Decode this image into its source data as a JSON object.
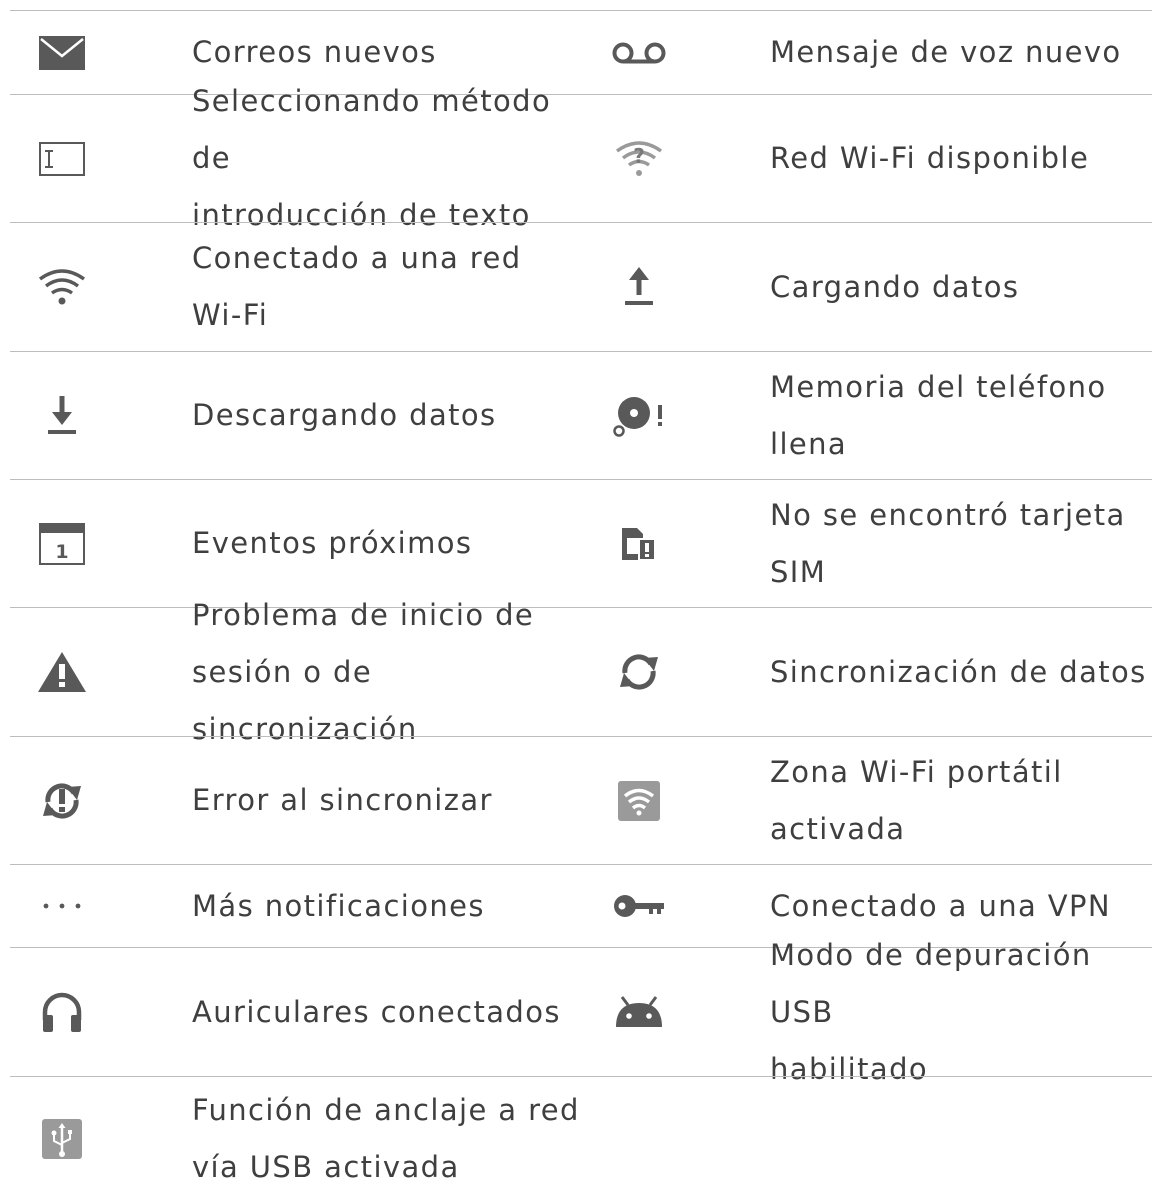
{
  "rows": [
    {
      "left": {
        "icon": "envelope-icon",
        "label": "Correos nuevos"
      },
      "right": {
        "icon": "voicemail-icon",
        "label": "Mensaje de voz nuevo"
      }
    },
    {
      "left": {
        "icon": "keyboard-input-icon",
        "label": "Seleccionando método de\nintroducción de texto"
      },
      "right": {
        "icon": "wifi-available-icon",
        "label": "Red Wi-Fi disponible"
      }
    },
    {
      "left": {
        "icon": "wifi-connected-icon",
        "label": "Conectado a una red\nWi-Fi"
      },
      "right": {
        "icon": "upload-icon",
        "label": "Cargando datos"
      }
    },
    {
      "left": {
        "icon": "download-icon",
        "label": "Descargando datos"
      },
      "right": {
        "icon": "storage-full-icon",
        "label": "Memoria del teléfono\nllena"
      }
    },
    {
      "left": {
        "icon": "calendar-icon",
        "label": "Eventos próximos",
        "calendar_day": "1"
      },
      "right": {
        "icon": "no-sim-icon",
        "label": "No se encontró tarjeta\nSIM"
      }
    },
    {
      "left": {
        "icon": "warning-icon",
        "label": "Problema de inicio de\nsesión o de sincronización"
      },
      "right": {
        "icon": "sync-icon",
        "label": "Sincronización de datos"
      }
    },
    {
      "left": {
        "icon": "sync-error-icon",
        "label": "Error al sincronizar"
      },
      "right": {
        "icon": "hotspot-icon",
        "label": "Zona Wi-Fi portátil\nactivada"
      }
    },
    {
      "left": {
        "icon": "more-icon",
        "label": "Más notificaciones"
      },
      "right": {
        "icon": "vpn-key-icon",
        "label": "Conectado a una VPN"
      }
    },
    {
      "left": {
        "icon": "headphones-icon",
        "label": "Auriculares conectados"
      },
      "right": {
        "icon": "android-debug-icon",
        "label": "Modo de depuración USB\nhabilitado"
      }
    },
    {
      "left": {
        "icon": "usb-icon",
        "label": "Función de anclaje a red\nvía USB activada"
      },
      "right": {
        "icon": "",
        "label": ""
      }
    }
  ],
  "colors": {
    "icon": "#595959",
    "text": "#3f3f3f",
    "rule": "#bdbdbd"
  }
}
